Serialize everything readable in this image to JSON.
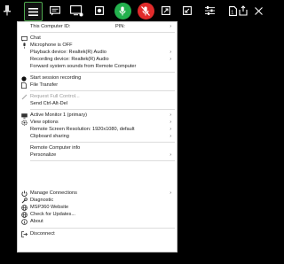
{
  "toolbar": {
    "icons": [
      "pin-icon",
      "menu-icon",
      "chat-icon",
      "monitor-icon",
      "stop-icon",
      "microphone-icon",
      "camera-off-icon",
      "fullscreen-icon",
      "scale-icon",
      "settings-icon",
      "page-icon",
      "info-icon",
      "close-icon"
    ]
  },
  "menu": {
    "header": {
      "computer_id_label": "This Computer ID:",
      "pin_label": "PIN:"
    },
    "items": [
      {
        "label": "Chat",
        "icon": "chat"
      },
      {
        "label": "Microphone is OFF",
        "icon": "mic"
      },
      {
        "label": "Playback device: Realtek(R) Audio",
        "submenu": true
      },
      {
        "label": "Recording device: Realtek(R) Audio",
        "submenu": true
      },
      {
        "label": "Forward system sounds from Remote Computer"
      },
      {
        "label": "Start session recording",
        "icon": "record"
      },
      {
        "label": "File Transfer",
        "icon": "file"
      },
      {
        "label": "Request Full Control...",
        "icon": "pencil",
        "disabled": true
      },
      {
        "label": "Send Ctrl-Alt-Del"
      },
      {
        "label": "Active Monitor 1 (primary)",
        "icon": "monitor",
        "submenu": true
      },
      {
        "label": "View options",
        "icon": "gear",
        "submenu": true
      },
      {
        "label": "Remote Screen Resolution: 1920x1080, default",
        "submenu": true
      },
      {
        "label": "Clipboard sharing",
        "submenu": true
      },
      {
        "label": "Remote Computer info"
      },
      {
        "label": "Personalize",
        "submenu": true
      },
      {
        "label": "Manage Connections",
        "icon": "power",
        "submenu": true
      },
      {
        "label": "Diagnostic",
        "icon": "wrench"
      },
      {
        "label": "MSP360 Website",
        "icon": "globe"
      },
      {
        "label": "Check for Updates...",
        "icon": "globe"
      },
      {
        "label": "About",
        "icon": "info"
      },
      {
        "label": "Disconnect",
        "icon": "exit"
      }
    ]
  }
}
